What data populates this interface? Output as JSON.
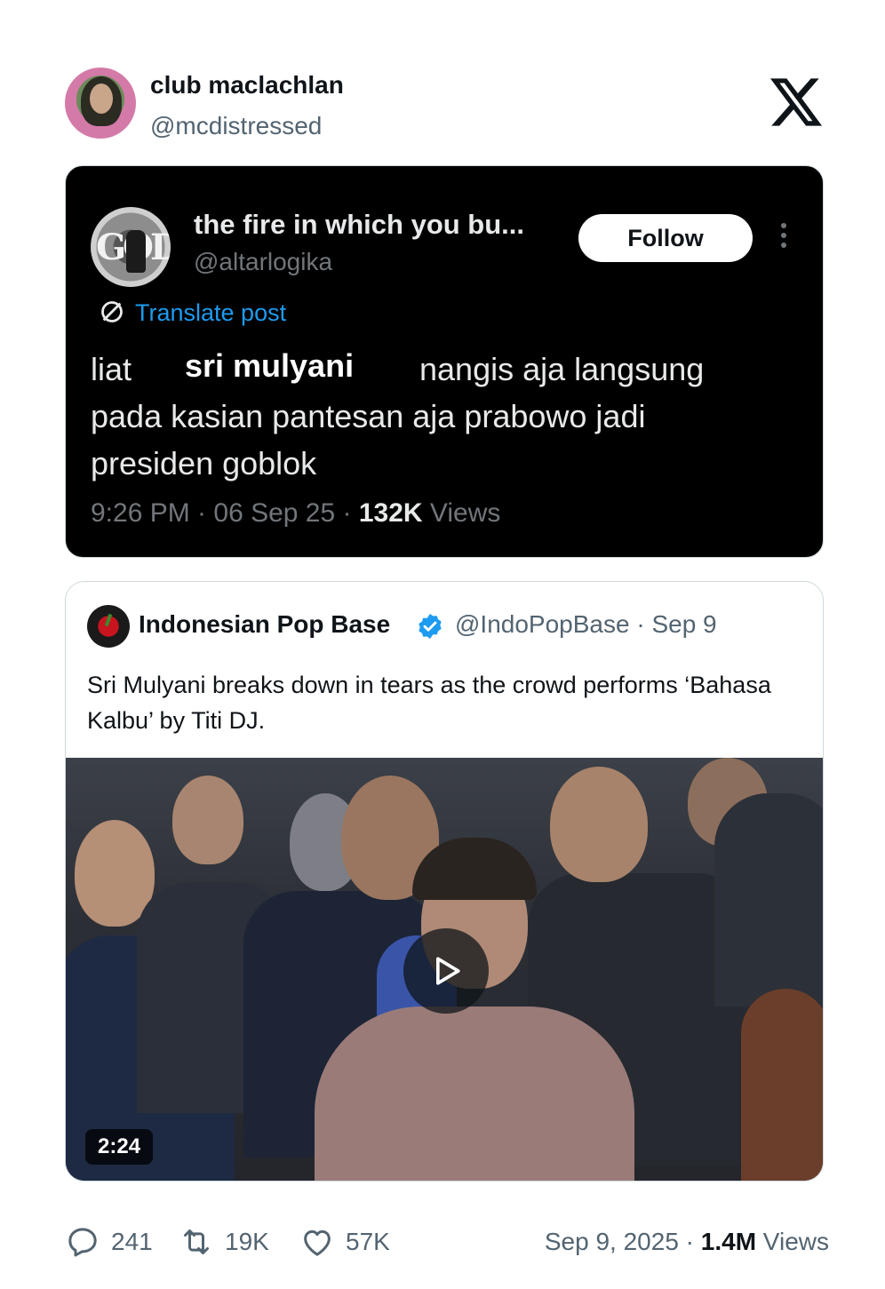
{
  "author": {
    "display_name": "club maclachlan",
    "handle": "@mcdistressed"
  },
  "brand": {
    "logo": "x-logo-icon"
  },
  "screenshot_post": {
    "display_name": "the fire in which you bu...",
    "handle": "@altarlogika",
    "follow_label": "Follow",
    "translate_label": "Translate post",
    "text": {
      "word1": "liat",
      "highlight": "sri mulyani",
      "rest1": "nangis aja langsung",
      "line2": "pada kasian pantesan aja prabowo jadi",
      "line3": "presiden goblok"
    },
    "time": "9:26 PM · 06 Sep 25 · ",
    "views_count": "132K",
    "views_label": " Views"
  },
  "quoted": {
    "display_name": "Indonesian Pop Base",
    "handle_date": "@IndoPopBase · Sep 9",
    "text": "Sri Mulyani breaks down in tears as the crowd performs ‘Bahasa Kalbu’ by Titi DJ.",
    "video_duration": "2:24"
  },
  "actions": {
    "replies": "241",
    "reposts": "19K",
    "likes": "57K",
    "date": "Sep 9, 2025 · ",
    "views_count": "1.4M",
    "views_label": " Views"
  },
  "colors": {
    "accent": "#1d9bf0",
    "text_primary": "#0f1419",
    "text_secondary": "#536471",
    "dark_bg": "#000000"
  }
}
